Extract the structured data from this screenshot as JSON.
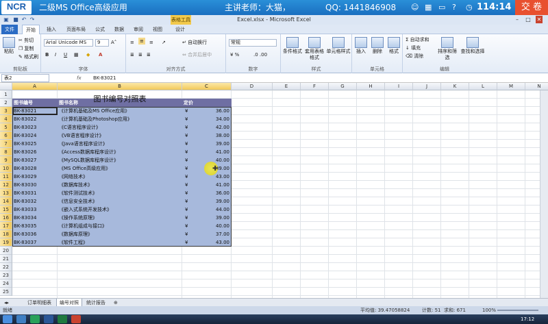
{
  "exam_bar": {
    "logo": "NCR",
    "subject": "二级MS Office高级应用",
    "teacher": "主讲老师：大猫，",
    "qq": "QQ: 1441846908",
    "timer": "114:14",
    "submit": "交 卷",
    "status_icons": [
      "person-icon",
      "calendar-icon",
      "folder-icon",
      "help-icon"
    ]
  },
  "titlebar": {
    "title": "Excel.xlsx - Microsoft Excel",
    "context_tab": "表格工具"
  },
  "tabs": [
    "文件",
    "开始",
    "插入",
    "页面布局",
    "公式",
    "数据",
    "审阅",
    "视图",
    "设计"
  ],
  "active_tab": "开始",
  "ribbon": {
    "clipboard": {
      "paste": "粘贴",
      "cut": "剪切",
      "copy": "复制",
      "format_painter": "格式刷",
      "label": "剪贴板"
    },
    "font": {
      "name": "Arial Unicode MS",
      "size": "9",
      "bold": "B",
      "italic": "I",
      "underline": "U",
      "label": "字体"
    },
    "alignment": {
      "wrap": "自动换行",
      "merge": "合并后居中",
      "label": "对齐方式"
    },
    "number": {
      "format": "常规",
      "label": "数字"
    },
    "styles": {
      "conditional": "条件格式",
      "table_format": "套用表格格式",
      "cell_styles": "单元格样式",
      "label": "样式"
    },
    "cells": {
      "insert": "插入",
      "delete": "删除",
      "format": "格式",
      "label": "单元格"
    },
    "editing": {
      "autosum": "自动求和",
      "fill": "填充",
      "clear": "清除",
      "sort": "排序和筛选",
      "find": "查找和选择",
      "label": "编辑"
    }
  },
  "formula_bar": {
    "name_box": "表2",
    "fx": "fx",
    "value": "BK-83021"
  },
  "columns": [
    "A",
    "B",
    "C",
    "D",
    "E",
    "F",
    "G",
    "H",
    "I",
    "J",
    "K",
    "L",
    "M",
    "N"
  ],
  "sheet": {
    "title": "图书编号对照表",
    "headers": [
      "图书编号",
      "图书名称",
      "定价"
    ],
    "currency": "¥",
    "rows": [
      [
        "BK-83021",
        "《计算机基础及MS Office应用》",
        "36.00"
      ],
      [
        "BK-83022",
        "《计算机基础及Photoshop应用》",
        "34.00"
      ],
      [
        "BK-83023",
        "《C语言程序设计》",
        "42.00"
      ],
      [
        "BK-83024",
        "《VB语言程序设计》",
        "38.00"
      ],
      [
        "BK-83025",
        "《Java语言程序设计》",
        "39.00"
      ],
      [
        "BK-83026",
        "《Access数据库程序设计》",
        "41.00"
      ],
      [
        "BK-83027",
        "《MySQL数据库程序设计》",
        "40.00"
      ],
      [
        "BK-83028",
        "《MS Office高级应用》",
        "39.00"
      ],
      [
        "BK-83029",
        "《网络技术》",
        "43.00"
      ],
      [
        "BK-83030",
        "《数据库技术》",
        "41.00"
      ],
      [
        "BK-83031",
        "《软件测试技术》",
        "36.00"
      ],
      [
        "BK-83032",
        "《信息安全技术》",
        "39.00"
      ],
      [
        "BK-83033",
        "《嵌入式系统开发技术》",
        "44.00"
      ],
      [
        "BK-83034",
        "《操作系统原理》",
        "39.00"
      ],
      [
        "BK-83035",
        "《计算机组成与接口》",
        "40.00"
      ],
      [
        "BK-83036",
        "《数据库原理》",
        "37.00"
      ],
      [
        "BK-83037",
        "《软件工程》",
        "43.00"
      ]
    ]
  },
  "sheet_tabs": [
    "订单明细表",
    "编号对照",
    "统计报告"
  ],
  "active_sheet": "编号对照",
  "status_bar": {
    "ready": "就绪",
    "average": "平均值: 39.47058824",
    "count": "计数: 51",
    "sum": "求和: 671",
    "zoom": "100%"
  },
  "taskbar_time": "17:12",
  "colors": {
    "header_fill": "#6f6fa3",
    "selection_fill": "#a7b9dc",
    "exam_bar": "#1a7fd0",
    "submit": "#e8502f"
  }
}
